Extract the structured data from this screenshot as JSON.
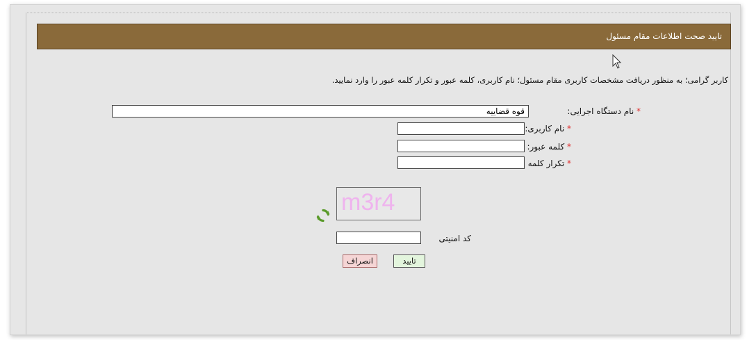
{
  "header": {
    "title": "تایید صحت اطلاعات مقام مسئول"
  },
  "intro_text": "کاربر گرامی؛ به منظور دریافت مشخصات کاربری مقام مسئول؛ نام کاربری، کلمه عبور و تکرار کلمه عبور را وارد نمایید.",
  "form": {
    "required_mark": "*",
    "org": {
      "label": "نام دستگاه اجرایی:",
      "value": "قوه قضاییه"
    },
    "username": {
      "label": "نام کاربری:",
      "value": ""
    },
    "password": {
      "label": "کلمه عبور:",
      "value": ""
    },
    "password_repeat": {
      "label": "تکرار کلمه عبور:",
      "value": ""
    },
    "captcha": {
      "image_text": "m3r4",
      "label": "کد امنیتی",
      "value": "",
      "refresh_icon": "refresh-arrows-icon"
    }
  },
  "buttons": {
    "confirm_label": "تایید",
    "cancel_label": "انصراف"
  },
  "colors": {
    "header_bg": "#8a6a3a",
    "panel_bg": "#e6e6e6",
    "required": "#e03030",
    "captcha_text": "#efb3ee",
    "refresh_icon": "#5a9a2a",
    "confirm_bg": "#e3f5dd",
    "cancel_bg": "#f5d5d5"
  }
}
